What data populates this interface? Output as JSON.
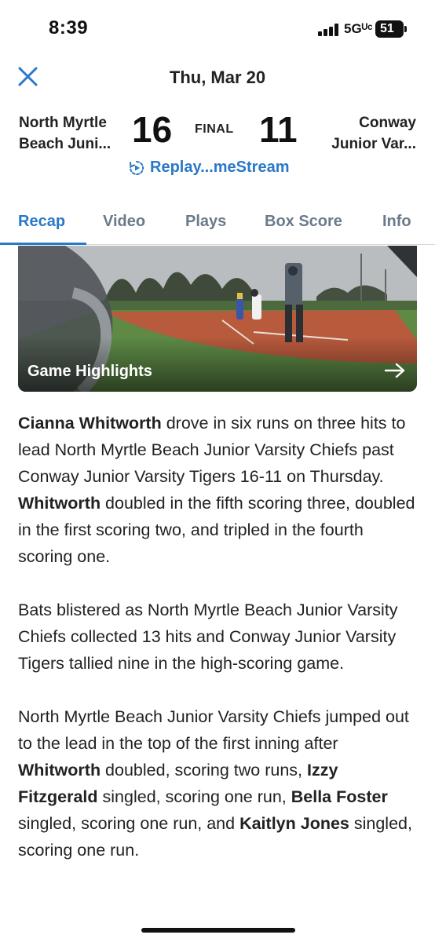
{
  "status_bar": {
    "time": "8:39",
    "network": "5Gᵁᶜ",
    "battery": "51"
  },
  "header": {
    "date": "Thu, Mar 20"
  },
  "game": {
    "home_team": "North Myrtle Beach Juni...",
    "home_team_line1": "North Myrtle",
    "home_team_line2": "Beach Juni...",
    "home_score": "16",
    "status": "FINAL",
    "away_score": "11",
    "away_team_line1": "Conway",
    "away_team_line2": "Junior Var...",
    "replay_label": "Replay...meStream"
  },
  "tabs": [
    {
      "label": "Recap",
      "active": true
    },
    {
      "label": "Video",
      "active": false
    },
    {
      "label": "Plays",
      "active": false
    },
    {
      "label": "Box Score",
      "active": false
    },
    {
      "label": "Info",
      "active": false
    }
  ],
  "highlights": {
    "title": "Game Highlights",
    "icon": "arrow-right-icon"
  },
  "article": {
    "p1": {
      "s1_bold": "Cianna Whitworth",
      "s1_text": " drove in six runs on three hits to lead North Myrtle Beach Junior Varsity Chiefs past Conway Junior Varsity Tigers 16-11 on Thursday. ",
      "s2_bold": "Whitworth",
      "s2_text": " doubled in the fifth scoring three, doubled in the first scoring two, and tripled in the fourth scoring one."
    },
    "p2": "Bats blistered as North Myrtle Beach Junior Varsity Chiefs collected 13 hits and Conway Junior Varsity Tigers tallied nine in the high-scoring game.",
    "p3": {
      "t1": "North Myrtle Beach Junior Varsity Chiefs jumped out to the lead in the top of the first inning after ",
      "b1": "Whitworth",
      "t2": " doubled, scoring two runs, ",
      "b2": "Izzy Fitzgerald",
      "t3": " singled, scoring one run, ",
      "b3": "Bella Foster",
      "t4": " singled, scoring one run, and ",
      "b4": "Kaitlyn Jones",
      "t5": " singled, scoring one run."
    }
  },
  "colors": {
    "accent": "#2a78c8",
    "text": "#222222",
    "tab_inactive": "#6b7a8a"
  }
}
